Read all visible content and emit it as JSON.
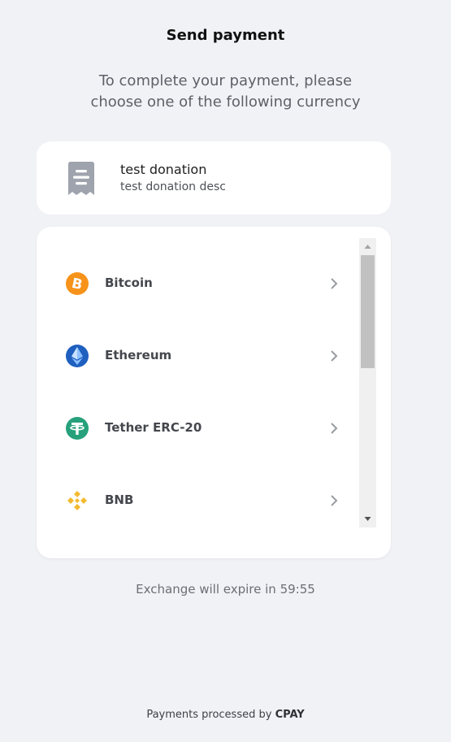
{
  "header": {
    "title": "Send payment",
    "subtitle": "To complete your payment, please choose one of the following currency"
  },
  "order": {
    "name": "test donation",
    "description": "test donation desc",
    "icon": "receipt-icon"
  },
  "currencies": [
    {
      "label": "Bitcoin",
      "icon": "bitcoin-icon",
      "color": "#f7931a"
    },
    {
      "label": "Ethereum",
      "icon": "ethereum-icon",
      "color": "#1565c0"
    },
    {
      "label": "Tether ERC-20",
      "icon": "tether-icon",
      "color": "#26a17b"
    },
    {
      "label": "BNB",
      "icon": "bnb-icon",
      "color": "#f3ba2f"
    }
  ],
  "expire": {
    "text": "Exchange will expire in 59:55"
  },
  "footer": {
    "prefix": "Payments processed by",
    "brand": "CPAY"
  }
}
